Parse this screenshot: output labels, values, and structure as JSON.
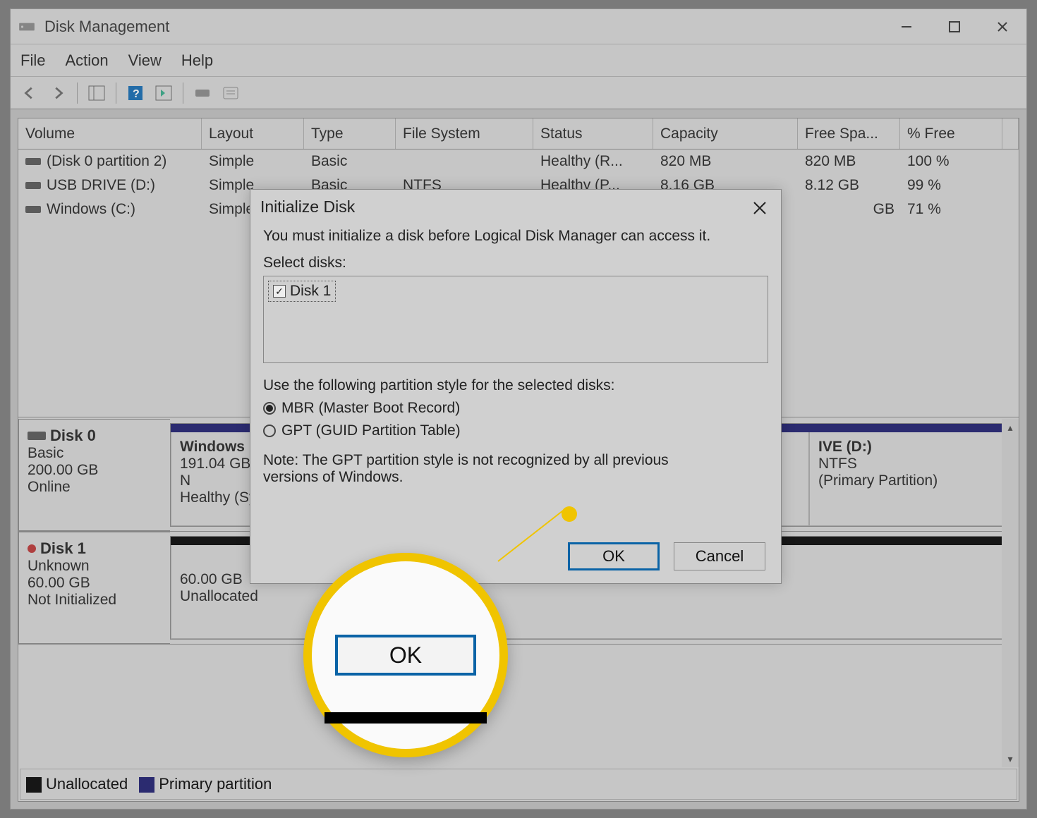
{
  "app": {
    "title": "Disk Management"
  },
  "menu": {
    "file": "File",
    "action": "Action",
    "view": "View",
    "help": "Help"
  },
  "columns": [
    "Volume",
    "Layout",
    "Type",
    "File System",
    "Status",
    "Capacity",
    "Free Spa...",
    "% Free"
  ],
  "volumes": [
    {
      "name": "(Disk 0 partition 2)",
      "layout": "Simple",
      "type": "Basic",
      "fs": "",
      "status": "Healthy (R...",
      "capacity": "820 MB",
      "free": "820 MB",
      "pct": "100 %"
    },
    {
      "name": "USB DRIVE (D:)",
      "layout": "Simple",
      "type": "Basic",
      "fs": "NTFS",
      "status": "Healthy (P...",
      "capacity": "8.16 GB",
      "free": "8.12 GB",
      "pct": "99 %"
    },
    {
      "name": "Windows (C:)",
      "layout": "Simple",
      "type": "",
      "fs": "",
      "status": "",
      "capacity": "",
      "free": "GB",
      "pct": "71 %"
    }
  ],
  "disk0": {
    "name": "Disk 0",
    "type": "Basic",
    "capacity": "200.00 GB",
    "status": "Online",
    "part1": {
      "title": "Windows",
      "size": "191.04 GB N",
      "status": "Healthy (Sy"
    },
    "part2": {
      "title": "IVE (D:)",
      "fs": "NTFS",
      "status": "(Primary Partition)"
    }
  },
  "disk1": {
    "name": "Disk 1",
    "type": "Unknown",
    "capacity": "60.00 GB",
    "status": "Not Initialized",
    "unalloc": {
      "size": "60.00 GB",
      "label": "Unallocated"
    }
  },
  "legend": {
    "unalloc": "Unallocated",
    "primary": "Primary partition"
  },
  "dialog": {
    "title": "Initialize Disk",
    "msg": "You must initialize a disk before Logical Disk Manager can access it.",
    "select_label": "Select disks:",
    "disk_item": "Disk 1",
    "style_label": "Use the following partition style for the selected disks:",
    "mbr": "MBR (Master Boot Record)",
    "gpt": "GPT (GUID Partition Table)",
    "note": "Note: The GPT partition style is not recognized by all previous versions of Windows.",
    "ok": "OK",
    "cancel": "Cancel"
  },
  "magnifier": {
    "ok": "OK"
  }
}
